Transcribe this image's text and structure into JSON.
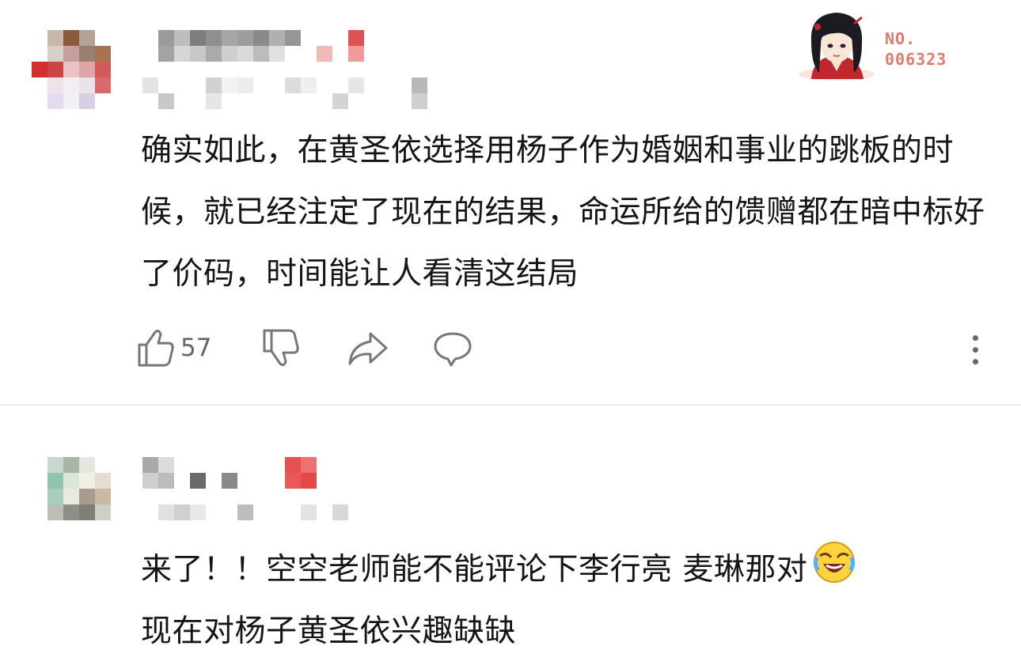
{
  "badge": {
    "number": "NO.\n006323"
  },
  "comments": [
    {
      "text": "确实如此，在黄圣依选择用杨子作为婚姻和事业的跳板的时候，就已经注定了现在的结果，命运所给的馈赠都在暗中标好了价码，时间能让人看清这结局",
      "likes": "57"
    },
    {
      "text": "来了！！空空老师能不能评论下李行亮 麦琳那对",
      "text_line2": "现在对杨子黄圣依兴趣缺缺"
    }
  ],
  "colors": {
    "accent": "#e04040",
    "icon": "#777777",
    "divider": "#ececec"
  },
  "icons": [
    "thumbs-up-icon",
    "thumbs-down-icon",
    "share-icon",
    "reply-icon",
    "more-icon",
    "laughing-crying-emoji"
  ]
}
